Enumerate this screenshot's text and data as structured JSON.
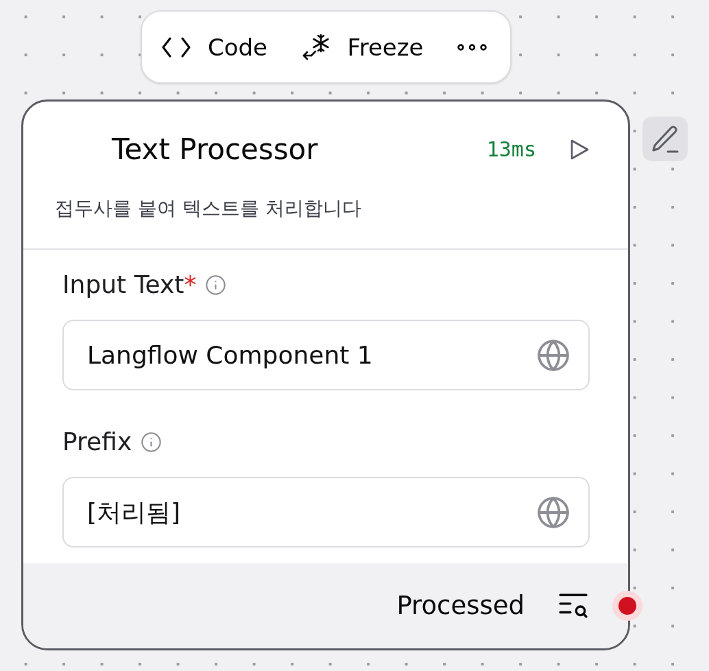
{
  "toolbar": {
    "items": [
      {
        "kind": "code",
        "label": "Code"
      },
      {
        "kind": "freeze",
        "label": "Freeze"
      },
      {
        "kind": "more"
      }
    ]
  },
  "node": {
    "title": "Text Processor",
    "duration": "13ms",
    "description": "접두사를 붙여 텍스트를 처리합니다",
    "fields": [
      {
        "label": "Input Text",
        "required_mark": "*",
        "value": "Langflow Component 1"
      },
      {
        "label": "Prefix",
        "value": "[처리됨]"
      }
    ],
    "output": {
      "label": "Processed"
    }
  }
}
